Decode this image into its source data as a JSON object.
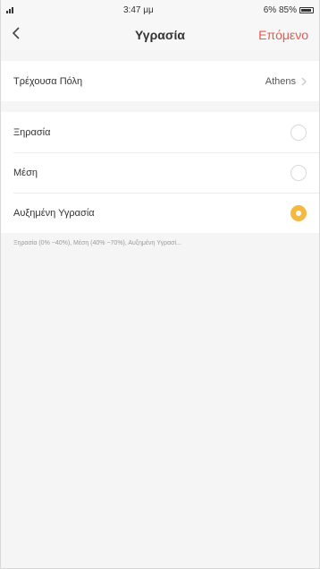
{
  "status_bar": {
    "time": "3:47 μμ",
    "battery": "6% 85%"
  },
  "nav": {
    "back_icon": "chevron-left-icon",
    "title": "Υγρασία",
    "next_label": "Επόμενο",
    "accent": "#e55a4e"
  },
  "city": {
    "label": "Τρέχουσα Πόλη",
    "value": "Athens"
  },
  "humidity_options": [
    {
      "label": "Ξηρασία",
      "selected": false
    },
    {
      "label": "Μέση",
      "selected": false
    },
    {
      "label": "Αυξημένη Υγρασία",
      "selected": true
    }
  ],
  "hint": "Ξηρασία (0% ~40%), Μέση (40% ~70%), Αυξημένη Υγρασί...",
  "colors": {
    "selected": "#f5b841"
  }
}
